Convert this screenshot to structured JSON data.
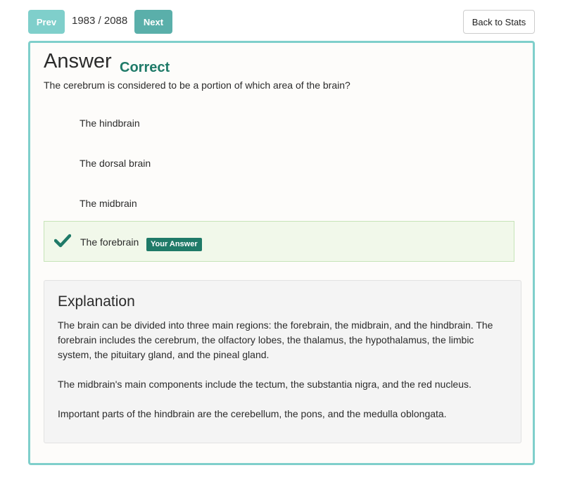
{
  "toolbar": {
    "prev_label": "Prev",
    "counter": "1983 / 2088",
    "next_label": "Next",
    "back_label": "Back to Stats"
  },
  "answer": {
    "heading": "Answer",
    "result": "Correct",
    "question": "The cerebrum is considered to be a portion of which area of the brain?",
    "options": [
      {
        "label": "The hindbrain",
        "selected": false
      },
      {
        "label": "The dorsal brain",
        "selected": false
      },
      {
        "label": "The midbrain",
        "selected": false
      },
      {
        "label": "The forebrain",
        "selected": true,
        "badge": "Your Answer"
      }
    ]
  },
  "explanation": {
    "title": "Explanation",
    "paragraphs": [
      "The brain can be divided into three main regions: the forebrain, the midbrain, and the hindbrain. The forebrain includes the cerebrum, the olfactory lobes, the thalamus, the hypothalamus, the limbic system, the pituitary gland, and the pineal gland.",
      "The midbrain's main components include the tectum, the substantia nigra, and the red nucleus.",
      "Important parts of the hindbrain are the cerebellum, the pons, and the medulla oblongata."
    ]
  },
  "colors": {
    "accent": "#7fcfcb",
    "correct": "#1f7a68",
    "selected_bg": "#f1f8ea"
  },
  "icons": {
    "selected_marker": "checkmark-icon"
  }
}
